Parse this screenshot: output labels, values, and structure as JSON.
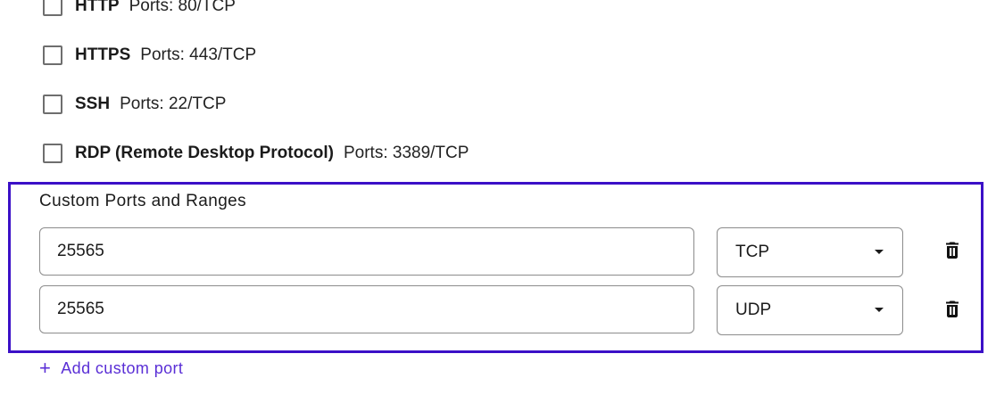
{
  "presets": [
    {
      "name": "HTTP",
      "ports": "Ports: 80/TCP",
      "checked": false
    },
    {
      "name": "HTTPS",
      "ports": "Ports: 443/TCP",
      "checked": false
    },
    {
      "name": "SSH",
      "ports": "Ports: 22/TCP",
      "checked": false
    },
    {
      "name": "RDP (Remote Desktop Protocol)",
      "ports": "Ports: 3389/TCP",
      "checked": false
    }
  ],
  "custom": {
    "title": "Custom Ports and Ranges",
    "rows": [
      {
        "port": "25565",
        "protocol": "TCP"
      },
      {
        "port": "25565",
        "protocol": "UDP"
      }
    ],
    "add_label": "Add custom port",
    "add_icon": "+"
  },
  "colors": {
    "accent": "#3b10c7",
    "link": "#5a2fd6"
  }
}
